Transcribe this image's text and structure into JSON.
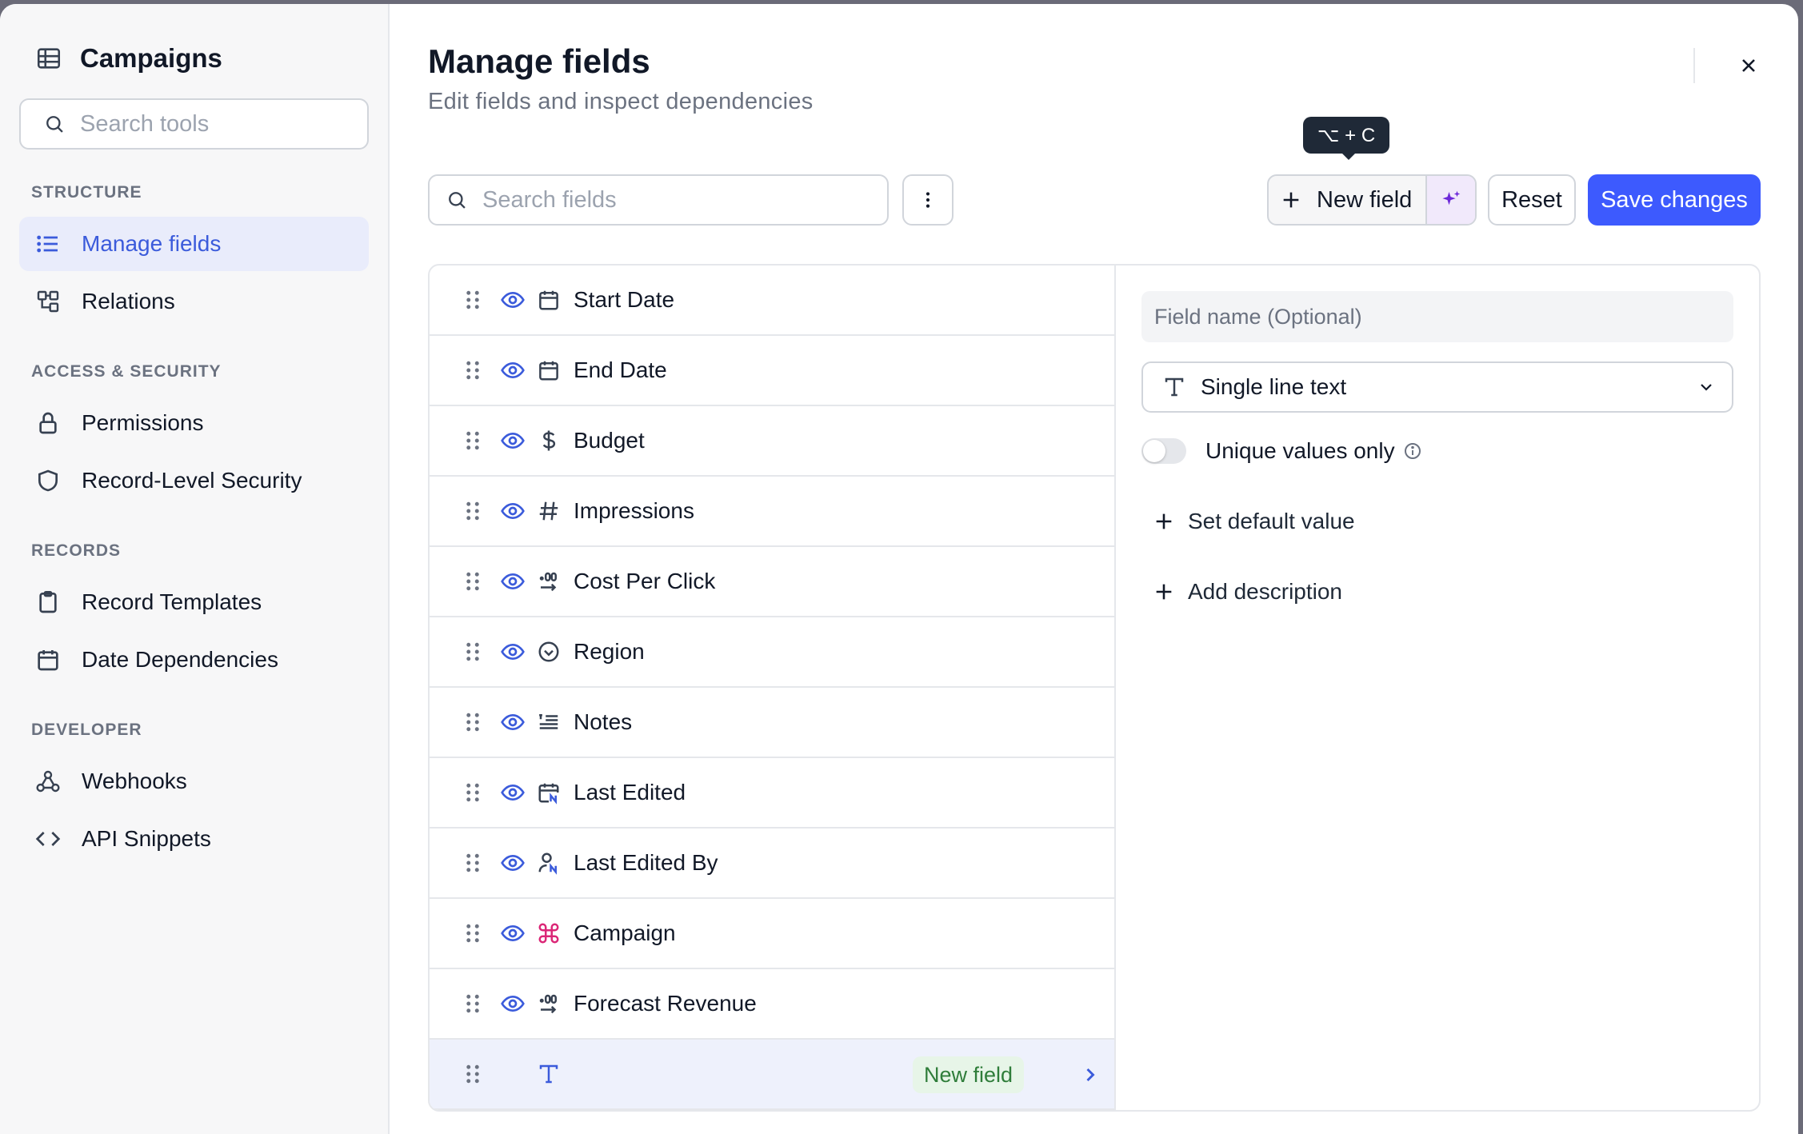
{
  "sidebar": {
    "title": "Campaigns",
    "search_placeholder": "Search tools",
    "sections": [
      {
        "label": "STRUCTURE",
        "items": [
          {
            "label": "Manage fields",
            "icon": "list-icon",
            "active": true
          },
          {
            "label": "Relations",
            "icon": "relations-icon",
            "active": false
          }
        ]
      },
      {
        "label": "ACCESS & SECURITY",
        "items": [
          {
            "label": "Permissions",
            "icon": "lock-icon",
            "active": false
          },
          {
            "label": "Record-Level Security",
            "icon": "shield-icon",
            "active": false
          }
        ]
      },
      {
        "label": "RECORDS",
        "items": [
          {
            "label": "Record Templates",
            "icon": "clipboard-icon",
            "active": false
          },
          {
            "label": "Date Dependencies",
            "icon": "calendar-icon",
            "active": false
          }
        ]
      },
      {
        "label": "DEVELOPER",
        "items": [
          {
            "label": "Webhooks",
            "icon": "webhook-icon",
            "active": false
          },
          {
            "label": "API Snippets",
            "icon": "code-icon",
            "active": false
          }
        ]
      }
    ]
  },
  "header": {
    "title": "Manage fields",
    "subtitle": "Edit fields and inspect dependencies"
  },
  "toolbar": {
    "search_placeholder": "Search fields",
    "new_field_label": "New field",
    "tooltip": "⌥ + C",
    "reset_label": "Reset",
    "save_label": "Save changes"
  },
  "fields": [
    {
      "name": "Start Date",
      "icon": "calendar-icon"
    },
    {
      "name": "End Date",
      "icon": "calendar-icon"
    },
    {
      "name": "Budget",
      "icon": "dollar-icon"
    },
    {
      "name": "Impressions",
      "icon": "hash-icon"
    },
    {
      "name": "Cost Per Click",
      "icon": "decimal-icon"
    },
    {
      "name": "Region",
      "icon": "select-circle-icon"
    },
    {
      "name": "Notes",
      "icon": "long-text-icon"
    },
    {
      "name": "Last Edited",
      "icon": "calendar-edit-icon"
    },
    {
      "name": "Last Edited By",
      "icon": "user-edit-icon"
    },
    {
      "name": "Campaign",
      "icon": "primary-key-icon"
    },
    {
      "name": "Forecast Revenue",
      "icon": "decimal-icon"
    }
  ],
  "new_row": {
    "badge": "New field",
    "icon": "text-type-icon"
  },
  "editor": {
    "name_placeholder": "Field name (Optional)",
    "type_value": "Single line text",
    "unique_label": "Unique values only",
    "unique_enabled": false,
    "default_value_label": "Set default value",
    "description_label": "Add description"
  },
  "colors": {
    "accent": "#3d5afe",
    "active_bg": "#e9ecfb",
    "badge_bg": "#e7f5e8",
    "badge_text": "#2f7d3a"
  }
}
